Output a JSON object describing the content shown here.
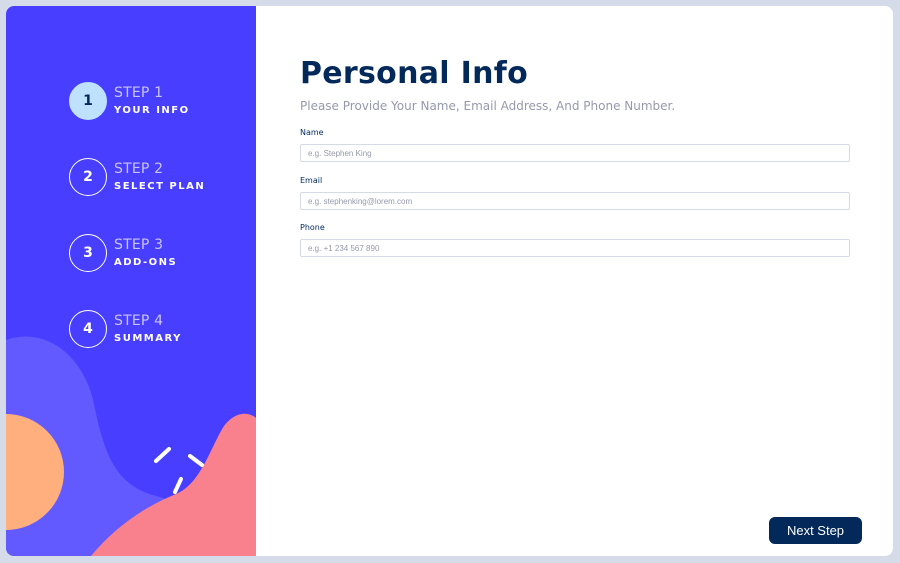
{
  "sidebar": {
    "steps": [
      {
        "number": "1",
        "title": "STEP 1",
        "label": "YOUR INFO"
      },
      {
        "number": "2",
        "title": "STEP 2",
        "label": "SELECT PLAN"
      },
      {
        "number": "3",
        "title": "STEP 3",
        "label": "ADD-ONS"
      },
      {
        "number": "4",
        "title": "STEP 4",
        "label": "SUMMARY"
      }
    ],
    "active_step": 1
  },
  "main": {
    "title": "Personal Info",
    "subtitle": "Please Provide Your Name, Email Address, And Phone Number.",
    "fields": [
      {
        "label": "Name",
        "placeholder": "e.g. Stephen King",
        "value": ""
      },
      {
        "label": "Email",
        "placeholder": "e.g. stephenking@lorem.com",
        "value": ""
      },
      {
        "label": "Phone",
        "placeholder": "e.g. +1 234 567 890",
        "value": ""
      }
    ],
    "next_button_label": "Next Step"
  },
  "colors": {
    "sidebar_bg": "#483eff",
    "active_step_bg": "#bee2fd",
    "title": "#02295a",
    "subtitle": "#9699ab",
    "button_bg": "#02295a",
    "blob_blue": "#6259ff",
    "blob_pink": "#f9818e",
    "blob_orange": "#ffaf7e"
  }
}
